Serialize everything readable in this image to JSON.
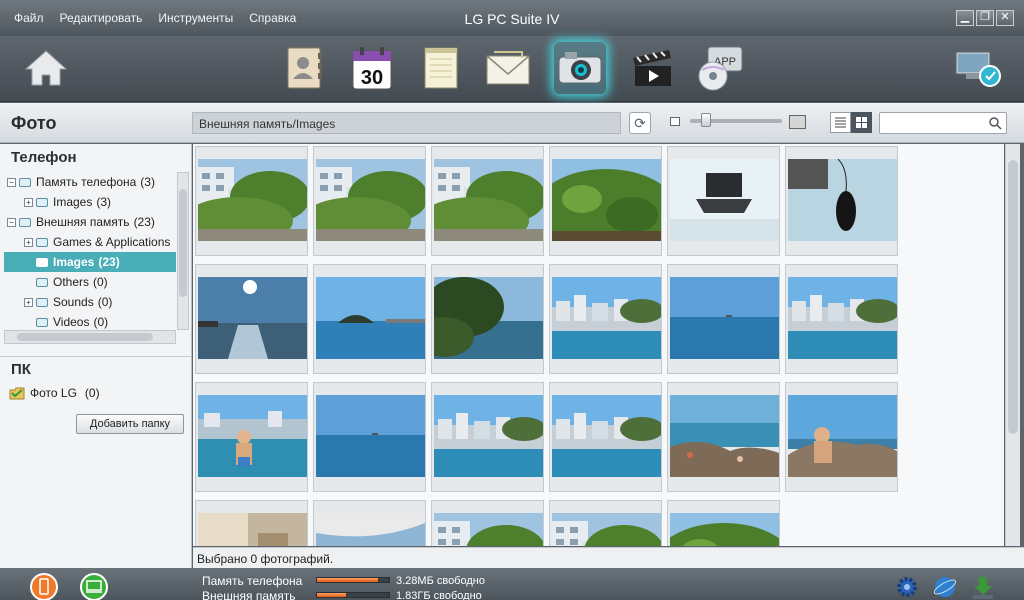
{
  "app": {
    "title": "LG PC Suite IV",
    "menu": [
      "Файл",
      "Редактировать",
      "Инструменты",
      "Справка"
    ]
  },
  "toolbar": {
    "icons": [
      "home-icon",
      "contacts-icon",
      "calendar-icon",
      "memo-icon",
      "messages-icon",
      "photo-icon",
      "video-icon",
      "app-icon",
      "sync-icon"
    ],
    "calendar_day": "30",
    "app_label": "APP",
    "active": "photo-icon"
  },
  "header": {
    "section_title": "Фото",
    "path": "Внешняя память/Images",
    "search_placeholder": ""
  },
  "left": {
    "phone_heading": "Телефон",
    "tree": [
      {
        "label": "Память телефона",
        "count": "(3)",
        "level": 0,
        "expander": "−"
      },
      {
        "label": "Images",
        "count": "(3)",
        "level": 1,
        "expander": "+"
      },
      {
        "label": "Внешняя память",
        "count": "(23)",
        "level": 0,
        "expander": "−"
      },
      {
        "label": "Games & Applications",
        "count": "",
        "level": 1,
        "expander": "+"
      },
      {
        "label": "Images",
        "count": "(23)",
        "level": 1,
        "expander": "",
        "selected": true
      },
      {
        "label": "Others",
        "count": "(0)",
        "level": 1,
        "expander": ""
      },
      {
        "label": "Sounds",
        "count": "(0)",
        "level": 1,
        "expander": "+"
      },
      {
        "label": "Videos",
        "count": "(0)",
        "level": 1,
        "expander": ""
      }
    ],
    "pc_heading": "ПК",
    "pc_folder": "Фото LG",
    "pc_count": "(0)",
    "add_folder": "Добавить папку"
  },
  "photos": [
    {
      "scene": "buildings-garden"
    },
    {
      "scene": "buildings-garden"
    },
    {
      "scene": "buildings-garden"
    },
    {
      "scene": "plants"
    },
    {
      "scene": "laptop"
    },
    {
      "scene": "mouse"
    },
    {
      "scene": "sunset-sea"
    },
    {
      "scene": "island-sea"
    },
    {
      "scene": "coast-trees"
    },
    {
      "scene": "town-coast"
    },
    {
      "scene": "sea-horizon"
    },
    {
      "scene": "town-coast"
    },
    {
      "scene": "beach-child"
    },
    {
      "scene": "sea-horizon"
    },
    {
      "scene": "town-coast"
    },
    {
      "scene": "town-coast"
    },
    {
      "scene": "rocks-beach"
    },
    {
      "scene": "rocks-child"
    },
    {
      "scene": "indoor"
    },
    {
      "scene": "balcony"
    },
    {
      "scene": "buildings-garden"
    },
    {
      "scene": "buildings-garden"
    },
    {
      "scene": "plants"
    }
  ],
  "status": {
    "selected_text": "Выбрано 0 фотографий."
  },
  "storage": [
    {
      "label": "Память телефона",
      "free": "3.28МБ свободно",
      "used_fraction": 0.85
    },
    {
      "label": "Внешняя память",
      "free": "1.83ГБ свободно",
      "used_fraction": 0.4
    }
  ],
  "colors": {
    "accent": "#4aaeb8",
    "orange": "#f07a2c",
    "green": "#3aae3a"
  }
}
